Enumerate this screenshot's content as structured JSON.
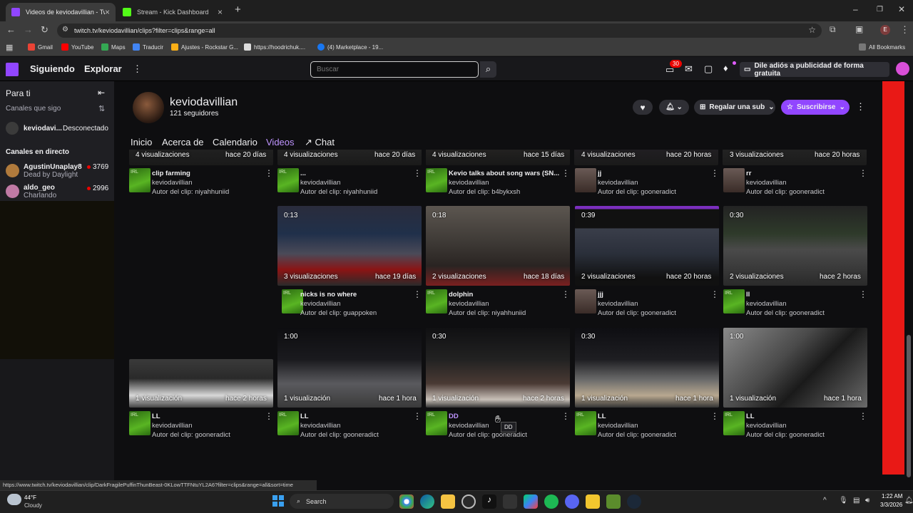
{
  "browser": {
    "tabs": [
      {
        "title": "Videos de keviodavillian - Twitch",
        "active": true,
        "favicon_color": "#9146ff"
      },
      {
        "title": "Stream - Kick Dashboard",
        "active": false,
        "favicon_color": "#53fc18"
      }
    ],
    "new_tab_glyph": "+",
    "url": "twitch.tv/keviodavillian/clips?filter=clips&range=all",
    "bookmarks": [
      {
        "label": "Gmail",
        "color": "#ea4335"
      },
      {
        "label": "YouTube",
        "color": "#ff0000"
      },
      {
        "label": "Maps",
        "color": "#34a853"
      },
      {
        "label": "Traducir",
        "color": "#4285f4"
      },
      {
        "label": "Ajustes - Rockstar G...",
        "color": "#fcaf17"
      },
      {
        "label": "https://hoodrichuk....",
        "color": "#dddddd"
      },
      {
        "label": "(4) Marketplace - 19...",
        "color": "#1877f2"
      }
    ],
    "all_bookmarks": "All Bookmarks",
    "status_url": "https://www.twitch.tv/keviodavillian/clip/DarkFragilePuffinThunBeast-0KLowTTFNtuYL2A6?filter=clips&range=all&sort=time",
    "avatar_letter": "E"
  },
  "twitch_nav": {
    "following": "Siguiendo",
    "browse": "Explorar",
    "search_placeholder": "Buscar",
    "notif_count": "30",
    "ad_free": "Dile adiós a publicidad de forma gratuita"
  },
  "sidebar": {
    "for_you": "Para ti",
    "followed_header": "Canales que sigo",
    "followed": [
      {
        "name": "keviodavi...",
        "status": "Desconectado"
      }
    ],
    "live_header": "Canales en directo",
    "live": [
      {
        "name": "AgustinUnaplay8",
        "game": "Dead by Daylight",
        "viewers": "3769"
      },
      {
        "name": "aldo_geo",
        "game": "Charlando",
        "viewers": "2996"
      }
    ]
  },
  "channel": {
    "name": "keviodavillian",
    "followers": "121 seguidores",
    "gift_sub": "Regalar una sub",
    "subscribe": "Suscribirse",
    "tabs": [
      "Inicio",
      "Acerca de",
      "Calendario",
      "Videos",
      "Chat"
    ],
    "active_tab": "Videos"
  },
  "clips_row1": [
    {
      "views": "4 visualizaciones",
      "ago": "hace 20 días",
      "title": "clip farming",
      "channel": "keviodavillian",
      "author": "Autor del clip: niyahhuniid"
    },
    {
      "views": "4 visualizaciones",
      "ago": "hace 20 días",
      "title": "...",
      "channel": "keviodavillian",
      "author": "Autor del clip: niyahhuniid"
    },
    {
      "views": "4 visualizaciones",
      "ago": "hace 15 días",
      "title": "Kevio talks about song wars (SN...",
      "channel": "keviodavillian",
      "author": "Autor del clip: b4bykxsh"
    },
    {
      "views": "4 visualizaciones",
      "ago": "hace 20 horas",
      "title": "jj",
      "channel": "keviodavillian",
      "author": "Autor del clip: gooneradict"
    },
    {
      "views": "3 visualizaciones",
      "ago": "hace 20 horas",
      "title": "rr",
      "channel": "keviodavillian",
      "author": "Autor del clip: gooneradict"
    }
  ],
  "clips_row2": [
    {
      "duration": "0:13",
      "views": "3 visualizaciones",
      "ago": "hace 19 días",
      "title": "nicks is no where",
      "channel": "keviodavillian",
      "author": "Autor del clip: guappoken"
    },
    {
      "duration": "0:18",
      "views": "2 visualizaciones",
      "ago": "hace 18 días",
      "title": "dolphin",
      "channel": "keviodavillian",
      "author": "Autor del clip: niyahhuniid"
    },
    {
      "duration": "0:39",
      "views": "2 visualizaciones",
      "ago": "hace 20 horas",
      "title": "jjj",
      "channel": "keviodavillian",
      "author": "Autor del clip: gooneradict"
    },
    {
      "duration": "0:30",
      "views": "2 visualizaciones",
      "ago": "hace 2 horas",
      "title": "ll",
      "channel": "keviodavillian",
      "author": "Autor del clip: gooneradict"
    }
  ],
  "clips_row3": [
    {
      "duration": "",
      "views": "1 visualización",
      "ago": "hace 2 horas",
      "title": "LL",
      "channel": "keviodavillian",
      "author": "Autor del clip: gooneradict"
    },
    {
      "duration": "1:00",
      "views": "1 visualización",
      "ago": "hace 1 hora",
      "title": "LL",
      "channel": "keviodavillian",
      "author": "Autor del clip: gooneradict"
    },
    {
      "duration": "0:30",
      "views": "1 visualización",
      "ago": "hace 2 horas",
      "title": "DD",
      "channel": "keviodavillian",
      "author": "Autor del clip: gooneradict"
    },
    {
      "duration": "0:30",
      "views": "1 visualización",
      "ago": "hace 1 hora",
      "title": "LL",
      "channel": "keviodavillian",
      "author": "Autor del clip: gooneradict"
    },
    {
      "duration": "1:00",
      "views": "1 visualización",
      "ago": "hace 1 hora",
      "title": "LL",
      "channel": "keviodavillian",
      "author": "Autor del clip: gooneradict"
    }
  ],
  "tooltip": "DD",
  "card_badge": "IRL",
  "taskbar": {
    "weather_temp": "44°F",
    "weather_desc": "Cloudy",
    "search": "Search",
    "time": "1:22 AM",
    "date": "3/3/2026"
  }
}
